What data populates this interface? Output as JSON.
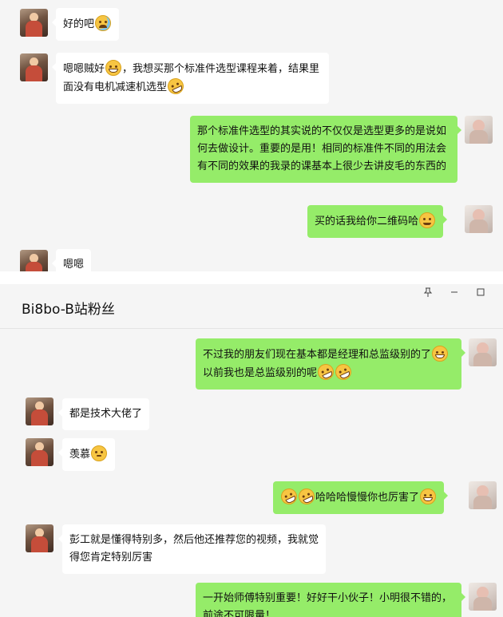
{
  "top_chat": {
    "messages": [
      {
        "side": "left",
        "parts": [
          {
            "t": "好的吧"
          },
          {
            "emoji": "crying-face"
          }
        ]
      },
      {
        "side": "left",
        "parts": [
          {
            "t": "嗯嗯贼好"
          },
          {
            "emoji": "grinning-face"
          },
          {
            "t": "，我想买那个标准件选型课程来着，结果里面没有电机减速机选型"
          },
          {
            "emoji": "laughing-tears-face"
          }
        ]
      },
      {
        "side": "right",
        "parts": [
          {
            "t": "那个标准件选型的其实说的不仅仅是选型更多的是说如何去做设计。重要的是用！相同的标准件不同的用法会有不同的效果的我录的课基本上很少去讲皮毛的东西的"
          }
        ]
      },
      {
        "side": "right",
        "parts": [
          {
            "t": "买的话我给你二维码哈"
          },
          {
            "emoji": "smiling-face"
          }
        ]
      },
      {
        "side": "left",
        "parts": [
          {
            "t": "嗯嗯"
          }
        ]
      }
    ]
  },
  "window": {
    "title": "Bi8bo-B站粉丝",
    "pin_icon": "pin-icon",
    "minimize_icon": "minimize-icon",
    "maximize_icon": "maximize-icon"
  },
  "bottom_chat": {
    "messages": [
      {
        "side": "right",
        "parts": [
          {
            "t": "不过我的朋友们现在基本都是经理和总监级别的了"
          },
          {
            "emoji": "grinning-face"
          },
          {
            "t": "以前我也是总监级别的呢"
          },
          {
            "emoji": "laughing-tears-face"
          },
          {
            "emoji": "laughing-tears-face"
          }
        ]
      },
      {
        "side": "left",
        "parts": [
          {
            "t": "都是技术大佬了"
          }
        ]
      },
      {
        "side": "left",
        "parts": [
          {
            "t": "羡慕"
          },
          {
            "emoji": "envious-face"
          }
        ]
      },
      {
        "side": "right",
        "parts": [
          {
            "emoji": "laughing-tears-face"
          },
          {
            "emoji": "laughing-tears-face"
          },
          {
            "t": "哈哈哈慢慢你也厉害了"
          },
          {
            "emoji": "grinning-face"
          }
        ]
      },
      {
        "side": "left",
        "parts": [
          {
            "t": "彭工就是懂得特别多，然后他还推荐您的视频，我就觉得您肯定特别厉害"
          }
        ]
      },
      {
        "side": "right",
        "parts": [
          {
            "t": "一开始师傅特别重要！好好干小伙子！小明很不错的，前途不可限量！"
          }
        ]
      }
    ]
  },
  "colors": {
    "outgoing_bubble": "#95ec69",
    "incoming_bubble": "#ffffff",
    "chat_background": "#f5f5f5"
  }
}
